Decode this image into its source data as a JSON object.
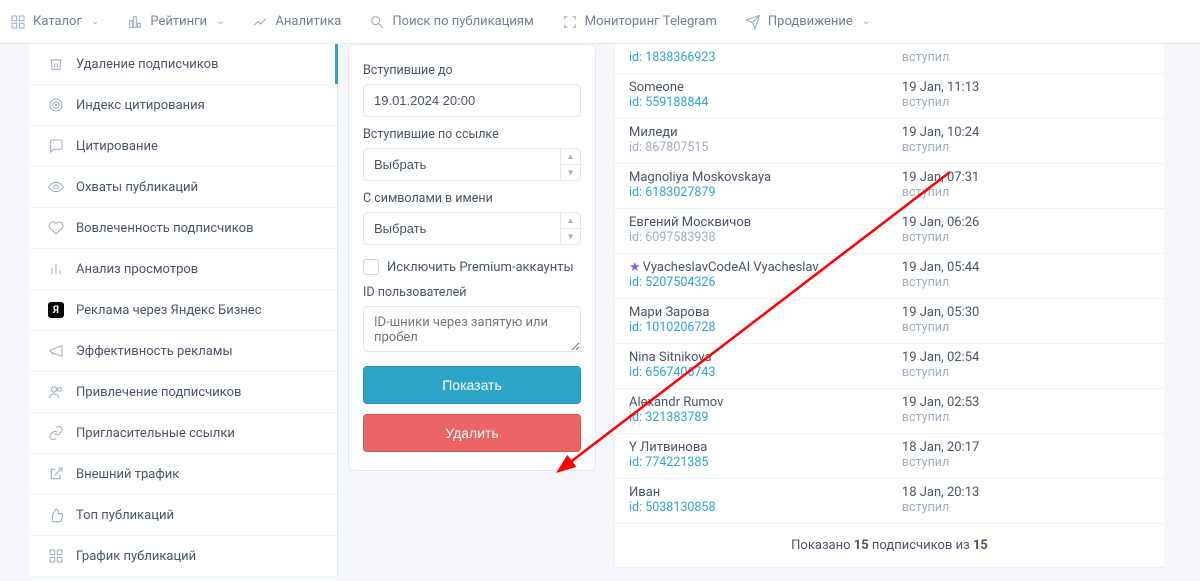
{
  "nav": [
    {
      "label": "Каталог",
      "dd": true
    },
    {
      "label": "Рейтинги",
      "dd": true
    },
    {
      "label": "Аналитика",
      "dd": false
    },
    {
      "label": "Поиск по публикациям",
      "dd": false
    },
    {
      "label": "Мониторинг Telegram",
      "dd": false
    },
    {
      "label": "Продвижение",
      "dd": true
    }
  ],
  "sidebar": [
    {
      "label": "Удаление подписчиков",
      "active": true,
      "icon": "trash"
    },
    {
      "label": "Индекс цитирования",
      "icon": "target"
    },
    {
      "label": "Цитирование",
      "icon": "quote"
    },
    {
      "label": "Охваты публикаций",
      "icon": "eye"
    },
    {
      "label": "Вовлеченность подписчиков",
      "icon": "heart"
    },
    {
      "label": "Анализ просмотров",
      "icon": "bars"
    },
    {
      "label": "Реклама через Яндекс Бизнес",
      "icon": "yb"
    },
    {
      "label": "Эффективность рекламы",
      "icon": "megaphone"
    },
    {
      "label": "Привлечение подписчиков",
      "icon": "users"
    },
    {
      "label": "Пригласительные ссылки",
      "icon": "link"
    },
    {
      "label": "Внешний трафик",
      "icon": "out"
    },
    {
      "label": "Топ публикаций",
      "icon": "thumb"
    },
    {
      "label": "График публикаций",
      "icon": "grid"
    }
  ],
  "filter": {
    "joined_before_label": "Вступившие до",
    "joined_before_value": "19.01.2024 20:00",
    "joined_by_link_label": "Вступившие по ссылке",
    "joined_by_link_value": "Выбрать",
    "name_symbols_label": "С символами в имени",
    "name_symbols_value": "Выбрать",
    "exclude_premium": "Исключить Premium-аккаунты",
    "user_ids_label": "ID пользователей",
    "user_ids_placeholder": "ID-шники через запятую или пробел",
    "show": "Показать",
    "delete": "Удалить"
  },
  "rows": [
    {
      "name": "",
      "id": "id: 1838366923",
      "time": "",
      "status": "вступил"
    },
    {
      "name": "Someone",
      "id": "id: 559188844",
      "time": "19 Jan, 11:13",
      "status": "вступил"
    },
    {
      "name": "Миледи",
      "id": "id: 867807515",
      "time": "19 Jan, 10:24",
      "status": "вступил",
      "mutedId": true
    },
    {
      "name": "Magnoliya Moskovskaya",
      "id": "id: 6183027879",
      "time": "19 Jan, 07:31",
      "status": "вступил"
    },
    {
      "name": "Евгений Москвичов",
      "id": "id: 6097583938",
      "time": "19 Jan, 06:26",
      "status": "вступил",
      "mutedId": true
    },
    {
      "name": "VyacheslavCodeAI Vyacheslav",
      "id": "id: 5207504326",
      "time": "19 Jan, 05:44",
      "status": "вступил",
      "star": true
    },
    {
      "name": "Мари Зарова",
      "id": "id: 1010206728",
      "time": "19 Jan, 05:30",
      "status": "вступил"
    },
    {
      "name": "Nina Sitnikova",
      "id": "id: 6567406743",
      "time": "19 Jan, 02:54",
      "status": "вступил"
    },
    {
      "name": "Alexandr Rumov",
      "id": "id: 321383789",
      "time": "19 Jan, 02:53",
      "status": "вступил"
    },
    {
      "name": "Y Литвинова",
      "id": "id: 774221385",
      "time": "18 Jan, 20:17",
      "status": "вступил"
    },
    {
      "name": "Иван",
      "id": "id: 5038130858",
      "time": "18 Jan, 20:13",
      "status": "вступил"
    }
  ],
  "summary": {
    "prefix": "Показано ",
    "n1": "15",
    "mid": " подписчиков из ",
    "n2": "15"
  }
}
